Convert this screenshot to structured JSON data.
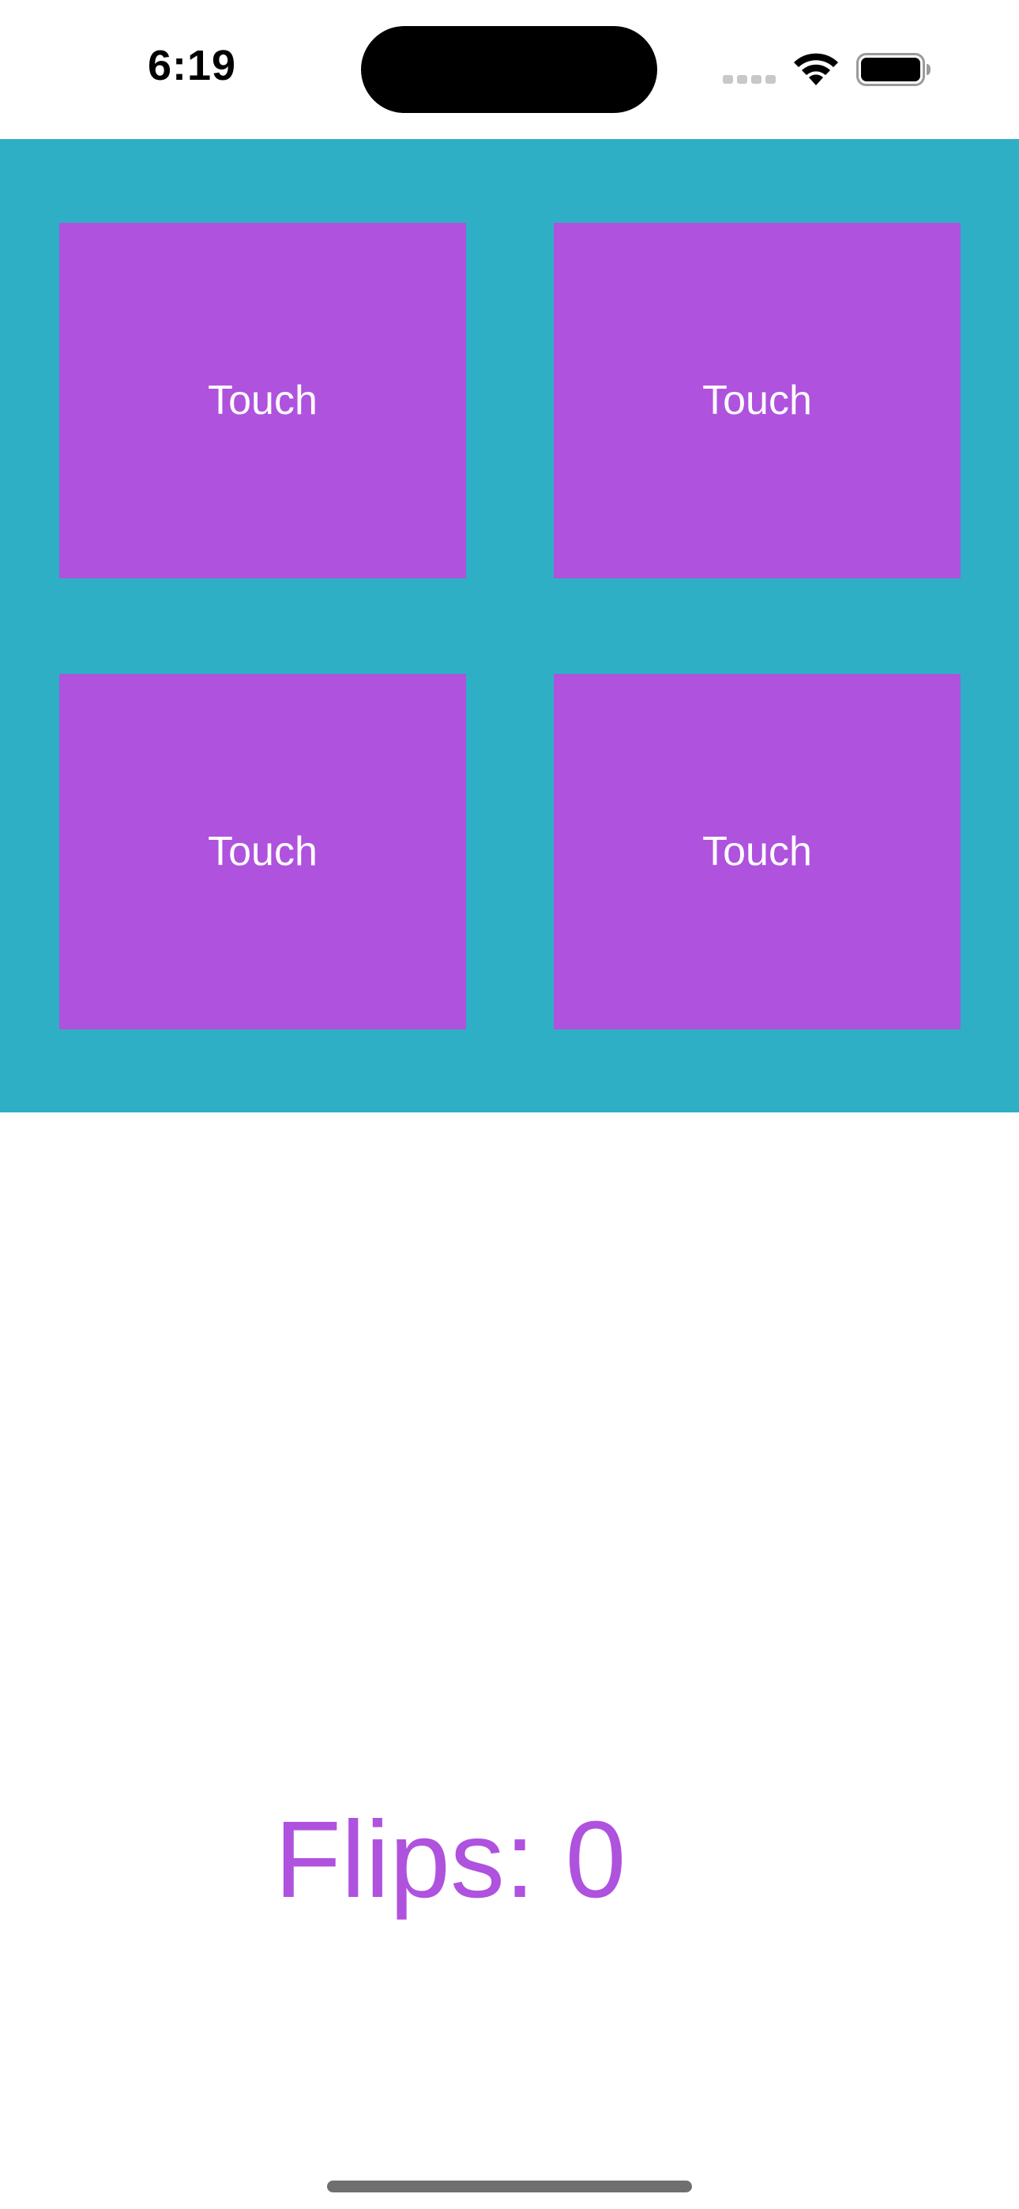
{
  "status_bar": {
    "time": "6:19",
    "signal_icon": "cellular-signal-icon",
    "wifi_icon": "wifi-icon",
    "battery_icon": "battery-icon"
  },
  "cards": [
    {
      "label": "Touch"
    },
    {
      "label": "Touch"
    },
    {
      "label": "Touch"
    },
    {
      "label": "Touch"
    }
  ],
  "flips": {
    "text": "Flips: 0"
  },
  "colors": {
    "card": "#AF52DE",
    "background": "#2FAFC5",
    "flips_text": "#AF52DE"
  }
}
